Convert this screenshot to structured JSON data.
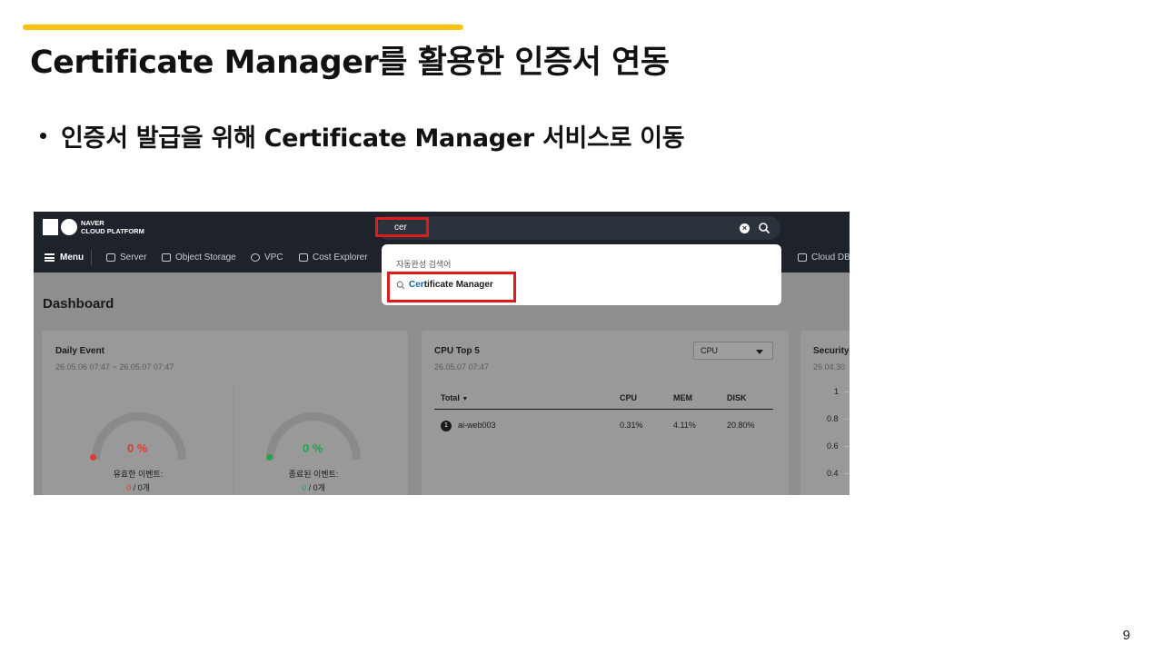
{
  "slide": {
    "title": "Certificate Manager를 활용한 인증서 연동",
    "bullet": "인증서 발급을 위해 Certificate Manager 서비스로 이동",
    "page_number": "9"
  },
  "colors": {
    "accent": "#f9c20f",
    "highlight_border": "#e11b1b",
    "topbar": "#1e232b",
    "red_status": "#e03a2f",
    "green_status": "#1fa64a"
  },
  "app": {
    "logo_line1": "NAVER",
    "logo_line2": "CLOUD PLATFORM",
    "search": {
      "value": "cer",
      "clear_icon": "close-circle-icon",
      "search_icon": "search-icon"
    },
    "nav": {
      "menu_label": "Menu",
      "items": [
        {
          "label": "Server",
          "icon": "server-icon"
        },
        {
          "label": "Object Storage",
          "icon": "storage-icon"
        },
        {
          "label": "VPC",
          "icon": "vpc-icon"
        },
        {
          "label": "Cost Explorer",
          "icon": "cost-icon"
        },
        {
          "label": "Cloud DB",
          "icon": "db-icon"
        }
      ]
    },
    "autocomplete": {
      "header": "자동완성 검색어",
      "item_match": "Cer",
      "item_rest": "tificate Manager"
    },
    "dashboard": {
      "title": "Dashboard",
      "daily_event": {
        "title": "Daily Event",
        "range": "26.05.06 07:47 ~ 26.05.07 07:47",
        "gauges": [
          {
            "percent": "0 %",
            "label": "유효한 이벤트:",
            "count_value": "0",
            "count_rest": " / 0개"
          },
          {
            "percent": "0 %",
            "label": "종료된 이벤트:",
            "count_value": "0",
            "count_rest": " / 0개"
          }
        ]
      },
      "cpu_top": {
        "title": "CPU Top 5",
        "date": "26.05.07 07:47",
        "select_value": "CPU",
        "columns": [
          "Total",
          "CPU",
          "MEM",
          "DISK"
        ],
        "rows": [
          {
            "rank": "1",
            "name": "ai-web003",
            "cpu": "0.31%",
            "mem": "4.11%",
            "disk": "20.80%"
          }
        ]
      },
      "security": {
        "title": "Security",
        "date": "26.04.30",
        "y_ticks": [
          "1",
          "0.8",
          "0.6",
          "0.4"
        ]
      }
    }
  }
}
